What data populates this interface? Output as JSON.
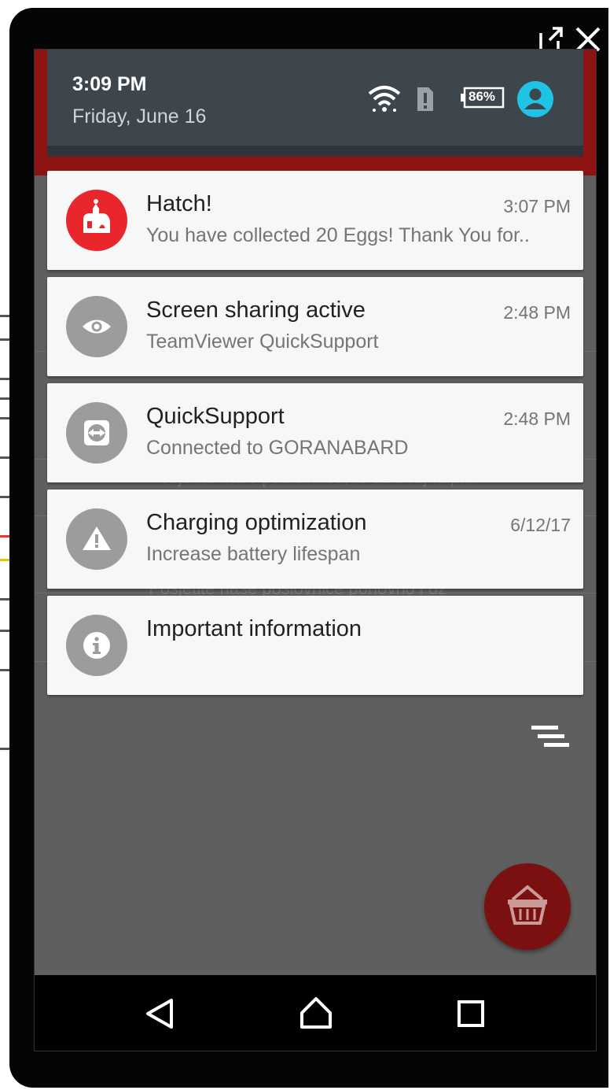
{
  "status_bar": {
    "time": "3:09 PM",
    "date": "Friday, June 16",
    "battery": "86%",
    "icons": [
      "wifi-icon",
      "sim-alert-icon",
      "battery-icon",
      "account-icon"
    ]
  },
  "notifications": [
    {
      "title": "Hatch!",
      "text": "You have collected 20 Eggs! Thank You for..",
      "time": "3:07 PM",
      "icon": "hatch-app-icon",
      "icon_color": "#e8262c"
    },
    {
      "title": "Screen sharing active",
      "text": "TeamViewer QuickSupport",
      "time": "2:48 PM",
      "icon": "eye-icon",
      "icon_color": "#9c9c9c"
    },
    {
      "title": "QuickSupport",
      "text": "Connected to GORANABARD",
      "time": "2:48 PM",
      "icon": "teamviewer-icon",
      "icon_color": "#9c9c9c"
    },
    {
      "title": "Charging optimization",
      "text": "Increase battery lifespan",
      "time": "6/12/17",
      "icon": "warning-icon",
      "icon_color": "#9c9c9c"
    },
    {
      "title": "Important information",
      "text": "",
      "time": "",
      "icon": "info-icon",
      "icon_color": "#9c9c9c"
    }
  ],
  "background_text": [
    "Posjetite naše poslovnice, te uz ovaj kup...",
    "Posjetite naše poslovnice ponovno i uz"
  ],
  "window_controls": [
    "popout-icon",
    "close-icon"
  ],
  "nav_buttons": [
    "back-icon",
    "home-icon",
    "recents-icon"
  ],
  "colors": {
    "header": "#3d464d",
    "hatch_red": "#e8262c",
    "fab": "#7a1010",
    "accent_account": "#1ec3e6"
  }
}
